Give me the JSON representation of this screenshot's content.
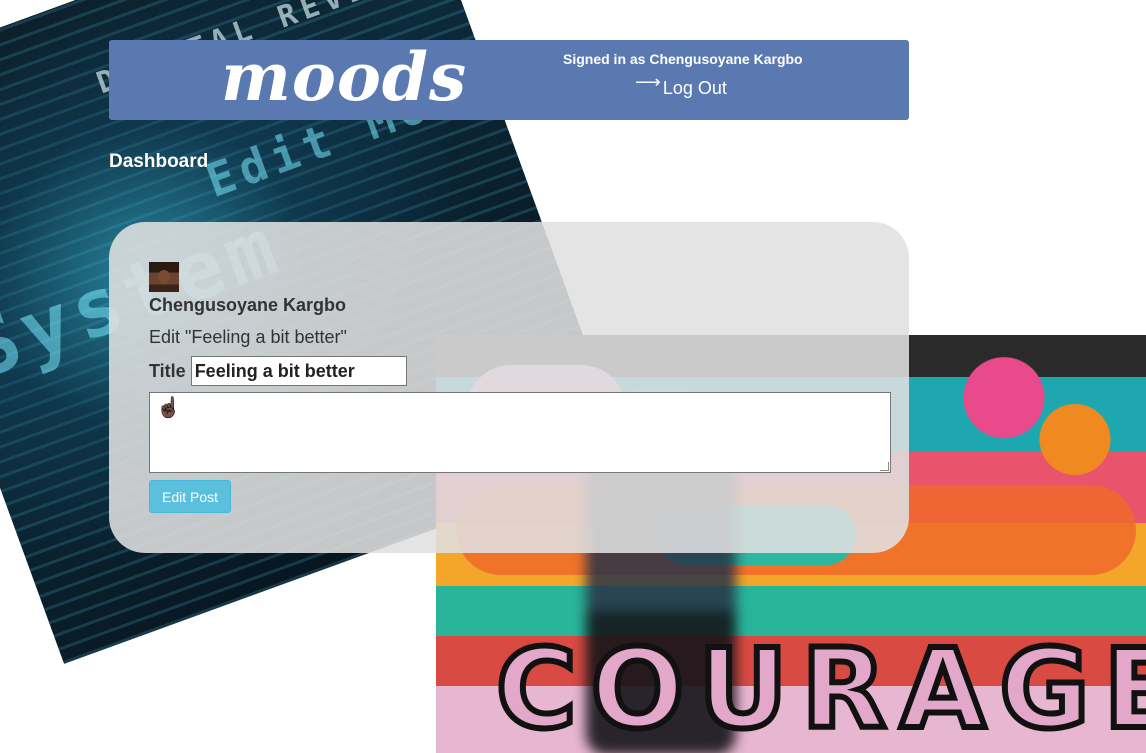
{
  "header": {
    "logo": "moods",
    "signed_in_text": "Signed in as Chengusoyane Kargbo",
    "logout_label": "Log Out",
    "logout_icon": "right-arrow-icon",
    "color": "#5a79b0"
  },
  "page": {
    "nav_label": "Dashboard"
  },
  "post_editor": {
    "author_name": "Chengusoyane Kargbo",
    "avatar_icon": "user-avatar",
    "heading": "Edit \"Feeling a bit better\"",
    "title_label": "Title",
    "title_value": "Feeling a bit better",
    "body_value": "☝🏿",
    "submit_label": "Edit Post",
    "submit_color": "#5bc0de"
  },
  "background": {
    "tech_image_text": [
      "DIGITAL REVE",
      "System",
      "Edit Mode"
    ],
    "graffiti_text": "COURAGE"
  }
}
